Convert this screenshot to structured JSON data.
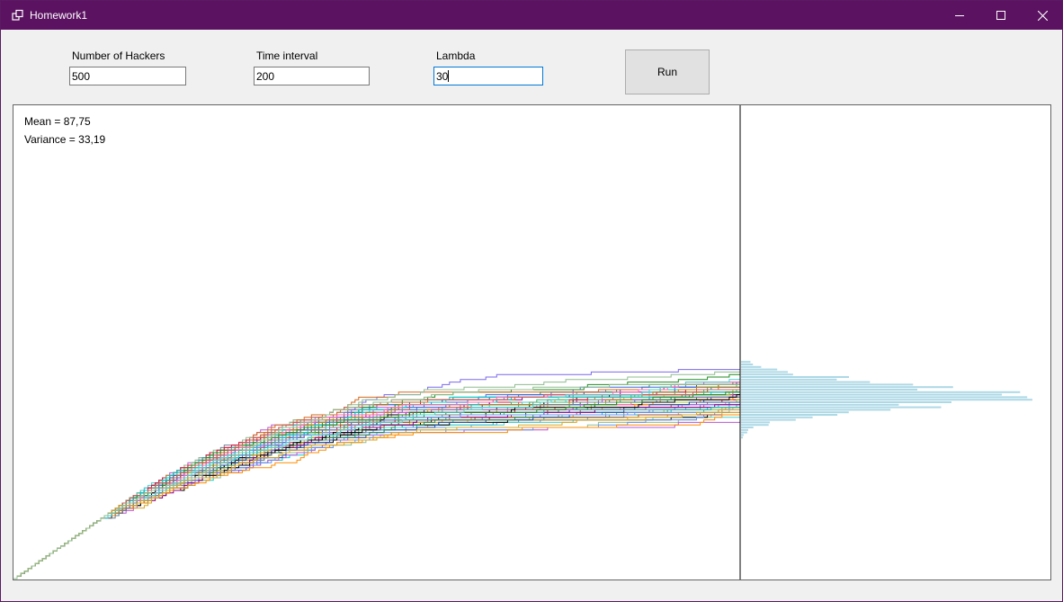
{
  "window": {
    "title": "Homework1",
    "titlebar_color": "#5b1361",
    "icons": {
      "app": "restore-windows-icon",
      "minimize": "minimize-icon",
      "maximize": "maximize-icon",
      "close": "close-icon"
    }
  },
  "controls": {
    "hackers_label": "Number of Hackers",
    "hackers_value": "500",
    "interval_label": "Time interval",
    "interval_value": "200",
    "lambda_label": "Lambda",
    "lambda_value": "30",
    "run_label": "Run"
  },
  "stats": {
    "mean": "Mean = 87,75",
    "variance": "Variance = 33,19"
  },
  "chart_data": {
    "type": "line",
    "x": [
      0,
      200
    ],
    "series_count": 500,
    "steps": 200,
    "mean_final": 87.75,
    "variance_final": 33.19,
    "histogram_color": "#add8e6",
    "divider_color": "#000000",
    "histogram_position": "right"
  }
}
